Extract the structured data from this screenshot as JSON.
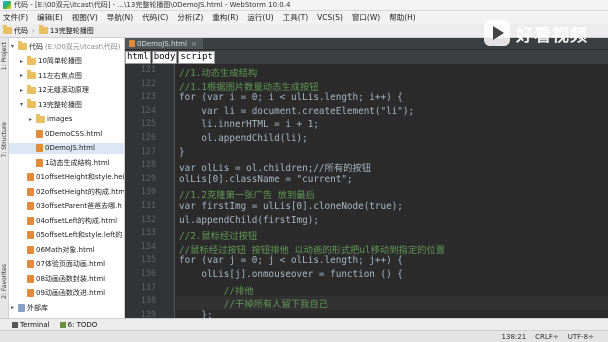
{
  "window": {
    "title": "代码 - [E:\\00双元\\itcast\\代码] - ...\\13完整轮播图\\0DemoJS.html - WebStorm 10.0.4"
  },
  "menu": [
    "文件(F)",
    "编辑(E)",
    "视图(V)",
    "导航(N)",
    "代码(C)",
    "分析(Z)",
    "重构(R)",
    "运行(U)",
    "工具(T)",
    "VCS(S)",
    "窗口(W)",
    "帮助(H)"
  ],
  "toolbar": {
    "crumbs": [
      "代码",
      "13完整轮播图"
    ]
  },
  "left_tabs": {
    "project": "1: Project",
    "structure": "7: Structure",
    "favorites": "2: Favorites"
  },
  "tree": [
    {
      "label": "代码",
      "extra": "(E:\\00双元\\itcast\\代码)",
      "type": "folder",
      "arrow": "▾",
      "indent": 0
    },
    {
      "label": "10简单轮播图",
      "type": "folder",
      "arrow": "▸",
      "indent": 1
    },
    {
      "label": "11左右焦点图",
      "type": "folder",
      "arrow": "▸",
      "indent": 1
    },
    {
      "label": "12无缝滚动原理",
      "type": "folder",
      "arrow": "▸",
      "indent": 1
    },
    {
      "label": "13完整轮播图",
      "type": "folder",
      "arrow": "▾",
      "indent": 1
    },
    {
      "label": "images",
      "type": "folder",
      "arrow": "▸",
      "indent": 2
    },
    {
      "label": "0DemoCSS.html",
      "type": "html",
      "arrow": "",
      "indent": 2
    },
    {
      "label": "0DemoJS.html",
      "type": "html",
      "arrow": "",
      "indent": 2,
      "selected": true
    },
    {
      "label": "1动态生成结构.html",
      "type": "html",
      "arrow": "",
      "indent": 2
    },
    {
      "label": "01offsetHeight和style.hei",
      "type": "html",
      "arrow": "",
      "indent": 1
    },
    {
      "label": "02offsetHeight的构成.htm",
      "type": "html",
      "arrow": "",
      "indent": 1
    },
    {
      "label": "03offsetParent爸爸去哪.h",
      "type": "html",
      "arrow": "",
      "indent": 1
    },
    {
      "label": "04offsetLeft的构成.html",
      "type": "html",
      "arrow": "",
      "indent": 1
    },
    {
      "label": "05offsetLeft和style.left的",
      "type": "html",
      "arrow": "",
      "indent": 1
    },
    {
      "label": "06Math对象.html",
      "type": "html",
      "arrow": "",
      "indent": 1
    },
    {
      "label": "07体验页面动画.html",
      "type": "html",
      "arrow": "",
      "indent": 1
    },
    {
      "label": "08动画函数封装.html",
      "type": "html",
      "arrow": "",
      "indent": 1
    },
    {
      "label": "09动画函数改进.html",
      "type": "html",
      "arrow": "",
      "indent": 1
    },
    {
      "label": "外部库",
      "type": "lib",
      "arrow": "▸",
      "indent": 0
    }
  ],
  "editor": {
    "tab": "0DemoJS.html",
    "crumbs": [
      "html",
      "body",
      "script"
    ],
    "lines": [
      {
        "n": "121",
        "text": "//1.动态生成结构",
        "comment": true,
        "indent": 12
      },
      {
        "n": "122",
        "text": "//1.1根据图片数量动态生成按钮",
        "comment": true,
        "indent": 12
      },
      {
        "n": "123",
        "text": "for (var i = 0; i < ulLis.length; i++) {",
        "indent": 12
      },
      {
        "n": "124",
        "text": "var li = document.createElement(\"li\");",
        "indent": 16
      },
      {
        "n": "125",
        "text": "li.innerHTML = i + 1;",
        "indent": 16
      },
      {
        "n": "126",
        "text": "ol.appendChild(li);",
        "indent": 16
      },
      {
        "n": "127",
        "text": "}",
        "indent": 12
      },
      {
        "n": "128",
        "text": "var olLis = ol.children;//所有的按钮",
        "indent": 12
      },
      {
        "n": "129",
        "text": "olLis[0].className = \"current\";",
        "indent": 12
      },
      {
        "n": "130",
        "text": "//1.2克隆第一张广告 放到最后",
        "comment": true,
        "indent": 12
      },
      {
        "n": "131",
        "text": "var firstImg = ulLis[0].cloneNode(true);",
        "indent": 12
      },
      {
        "n": "132",
        "text": "ul.appendChild(firstImg);",
        "indent": 12
      },
      {
        "n": "133",
        "text": "//2.鼠标经过按钮",
        "comment": true,
        "indent": 12
      },
      {
        "n": "134",
        "text": "//鼠标经过按钮 按钮排他 以动画的形式把ul移动到指定的位置",
        "comment": true,
        "indent": 12
      },
      {
        "n": "135",
        "text": "for (var j = 0; j < olLis.length; j++) {",
        "indent": 12
      },
      {
        "n": "136",
        "text": "olLis[j].onmouseover = function () {",
        "indent": 16
      },
      {
        "n": "137",
        "text": "//排他",
        "comment": true,
        "indent": 20
      },
      {
        "n": "138",
        "text": "//干掉所有人留下我自己",
        "comment": true,
        "indent": 20,
        "current": true
      },
      {
        "n": "139",
        "text": "};",
        "indent": 16
      }
    ]
  },
  "watermark": {
    "text": "好看视频"
  },
  "bottom_tabs": [
    "Terminal",
    "6: TODO"
  ],
  "status": {
    "position": "138:21",
    "line_sep": "CRLF÷",
    "encoding": "UTF-8÷"
  }
}
